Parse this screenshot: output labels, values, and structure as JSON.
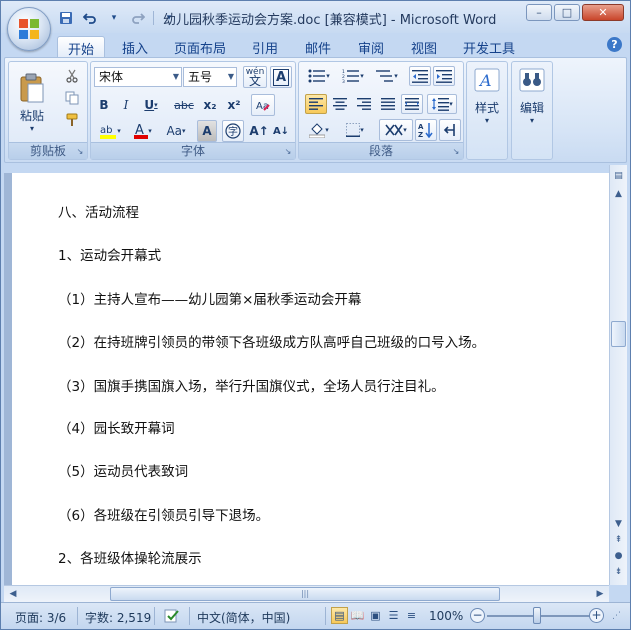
{
  "window": {
    "title": "幼儿园秋季运动会方案.doc [兼容模式] - Microsoft Word",
    "controls": {
      "minimize": "–",
      "maximize": "□",
      "close": "✕"
    }
  },
  "quick_access": {
    "save": "💾",
    "undo": "↶",
    "redo": "↷",
    "customize": "▾"
  },
  "tabs": [
    "开始",
    "插入",
    "页面布局",
    "引用",
    "邮件",
    "审阅",
    "视图",
    "开发工具"
  ],
  "ribbon": {
    "clipboard": {
      "label": "剪贴板",
      "paste": "粘贴"
    },
    "font": {
      "label": "字体",
      "font_name": "宋体",
      "font_size": "五号",
      "wen_button": "wén\n文",
      "bold": "B",
      "italic": "I",
      "underline": "U",
      "strike": "abc",
      "subscript": "x₂",
      "superscript": "x²",
      "change_case": "Aa",
      "grow": "A↑",
      "shrink": "A↓"
    },
    "paragraph": {
      "label": "段落"
    },
    "styles": {
      "label": "样式"
    },
    "editing": {
      "label": "编辑"
    }
  },
  "document": {
    "lines": [
      "八、活动流程",
      "1、运动会开幕式",
      "（1）主持人宣布——幼儿园第×届秋季运动会开幕",
      "（2）在持班牌引领员的带领下各班级成方队高呼自己班级的口号入场。",
      "（3）国旗手携国旗入场，举行升国旗仪式，全场人员行注目礼。",
      "（4）园长致开幕词",
      "（5）运动员代表致词",
      "（6）各班级在引领员引导下退场。",
      "2、各班级体操轮流展示"
    ]
  },
  "statusbar": {
    "page": "页面: 3/6",
    "words": "字数: 2,519",
    "language": "中文(简体，中国)",
    "zoom": "100%",
    "zoom_level": 1.0
  },
  "colors": {
    "accent": "#c4d8f2",
    "highlight": "#ffff00",
    "font_color": "#e00000"
  }
}
